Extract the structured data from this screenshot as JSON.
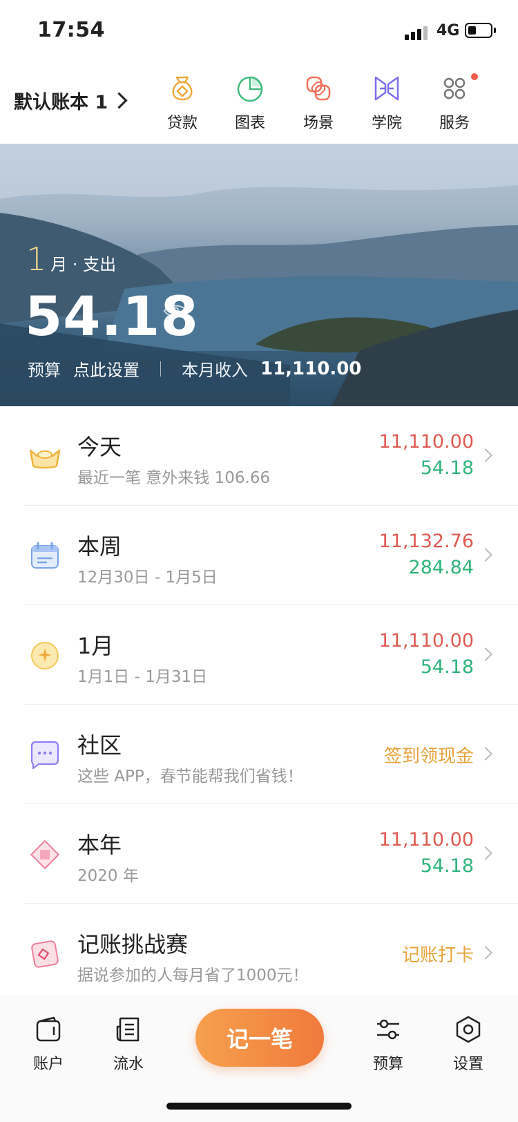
{
  "status_bar": {
    "time": "17:54",
    "network": "4G"
  },
  "header": {
    "book_name": "默认账本 1",
    "nav": [
      {
        "label": "贷款",
        "icon": "loan-bag-icon"
      },
      {
        "label": "图表",
        "icon": "pie-chart-icon"
      },
      {
        "label": "场景",
        "icon": "scene-knot-icon"
      },
      {
        "label": "学院",
        "icon": "academy-butterfly-icon"
      },
      {
        "label": "服务",
        "icon": "services-grid-icon",
        "badge": true
      }
    ]
  },
  "banner": {
    "month_num": "1",
    "month_text": "月 · 支出",
    "amount": "54.18",
    "budget_label": "预算",
    "budget_action": "点此设置",
    "income_label": "本月收入",
    "income_value": "11,110.00"
  },
  "list": [
    {
      "title": "今天",
      "subtitle": "最近一笔 意外来钱 106.66",
      "income": "11,110.00",
      "expense": "54.18",
      "icon": "gold-ingot-icon"
    },
    {
      "title": "本周",
      "subtitle": "12月30日 - 1月5日",
      "income": "11,132.76",
      "expense": "284.84",
      "icon": "calendar-icon"
    },
    {
      "title": "1月",
      "subtitle": "1月1日 - 1月31日",
      "income": "11,110.00",
      "expense": "54.18",
      "icon": "moon-star-icon"
    },
    {
      "title": "社区",
      "subtitle": "这些 APP，春节能帮我们省钱！",
      "action": "签到领现金",
      "icon": "chat-bubble-icon"
    },
    {
      "title": "本年",
      "subtitle": "2020 年",
      "income": "11,110.00",
      "expense": "54.18",
      "icon": "diamond-icon"
    },
    {
      "title": "记账挑战赛",
      "subtitle": "据说参加的人每月省了1000元！",
      "action": "记账打卡",
      "icon": "red-envelope-icon"
    }
  ],
  "tabbar": {
    "tabs": [
      {
        "label": "账户",
        "icon": "wallet-icon"
      },
      {
        "label": "流水",
        "icon": "ledger-icon"
      },
      {
        "label": "预算",
        "icon": "sliders-icon"
      },
      {
        "label": "设置",
        "icon": "hexagon-settings-icon"
      }
    ],
    "record_label": "记一笔"
  },
  "colors": {
    "income": "#e05a52",
    "expense": "#2fb37c",
    "action": "#e8a33d",
    "record_button": "#f07a3c"
  }
}
